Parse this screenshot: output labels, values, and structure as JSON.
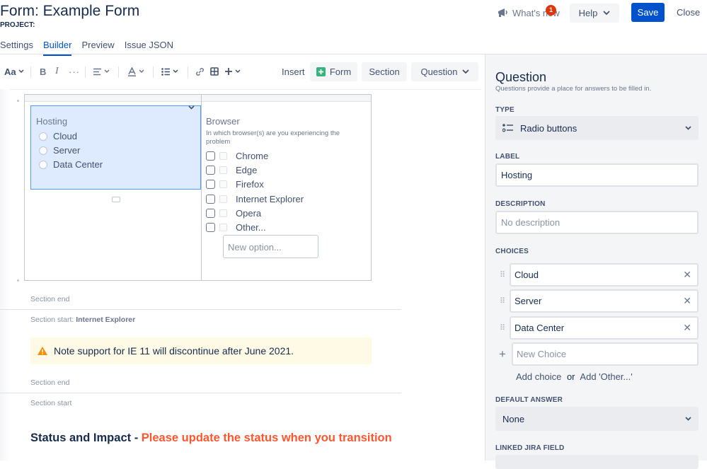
{
  "header": {
    "title": "Form: Example Form",
    "project_label": "PROJECT:",
    "whats_new": "What's new",
    "badge_count": "1",
    "help": "Help",
    "save": "Save",
    "close": "Close"
  },
  "tabs": [
    {
      "label": "Settings",
      "active": false
    },
    {
      "label": "Builder",
      "active": true
    },
    {
      "label": "Preview",
      "active": false
    },
    {
      "label": "Issue JSON",
      "active": false
    }
  ],
  "toolbar": {
    "text_style": "Aa",
    "insert": "Insert",
    "form": "Form",
    "section": "Section",
    "question": "Question"
  },
  "editor": {
    "hosting": {
      "label": "Hosting",
      "options": [
        "Cloud",
        "Server",
        "Data Center"
      ]
    },
    "browser": {
      "label": "Browser",
      "description": "In which browser(s) are you experiencing the problem",
      "options": [
        "Chrome",
        "Edge",
        "Firefox",
        "Internet Explorer",
        "Opera",
        "Other..."
      ],
      "new_option_placeholder": "New option..."
    },
    "section_end_1": "Section end",
    "section_start_ie_prefix": "Section start:",
    "section_start_ie_name": "Internet Explorer",
    "warning": "Note support for IE 11 will discontinue after June 2021.",
    "section_end_2": "Section end",
    "section_start_2": "Section start",
    "status_heading": "Status and Impact - ",
    "status_heading_red": "Please update the status when you transition"
  },
  "panel": {
    "title": "Question",
    "subtitle": "Questions provide a place for answers to be filled in.",
    "type_label": "TYPE",
    "type_value": "Radio buttons",
    "label_label": "LABEL",
    "label_value": "Hosting",
    "description_label": "DESCRIPTION",
    "description_placeholder": "No description",
    "choices_label": "CHOICES",
    "choices": [
      "Cloud",
      "Server",
      "Data Center"
    ],
    "new_choice_placeholder": "New Choice",
    "add_choice": "Add choice",
    "or": "or",
    "add_other": "Add 'Other...'",
    "default_answer_label": "DEFAULT ANSWER",
    "default_answer_value": "None",
    "linked_jira_label": "LINKED JIRA FIELD"
  },
  "colors": {
    "primary": "#0052cc",
    "badge": "#de350b",
    "warning_bg": "#fffae6",
    "warning_icon": "#ff8b00",
    "heading_red": "#ff5630",
    "selected_bg": "#deebff"
  }
}
